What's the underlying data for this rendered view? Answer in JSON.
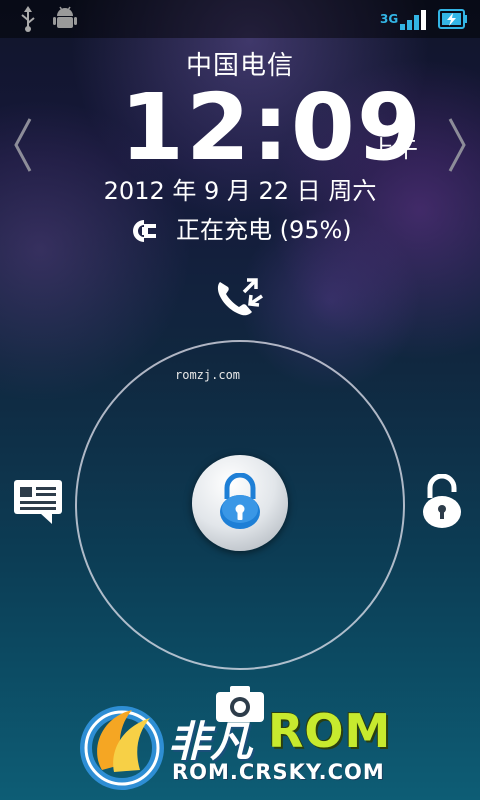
{
  "status_bar": {
    "network_type": "3G",
    "icons": [
      "usb-icon",
      "android-debug-icon",
      "signal-icon",
      "battery-charging-icon"
    ]
  },
  "lockscreen": {
    "carrier": "中国电信",
    "time": "12:09",
    "ampm": "上午",
    "date": "2012 年 9 月 22 日 周六",
    "charging_status": "正在充电 (95%)"
  },
  "watermark": "romzj.com",
  "unlock_targets": {
    "top": "missed-call-icon",
    "left": "message-icon",
    "right": "unlock-icon",
    "bottom": "camera-icon",
    "center": "lock-icon"
  },
  "brand": {
    "name_cn": "非凡",
    "name_rom": "ROM",
    "url": "ROM.CRSKY.COM"
  },
  "colors": {
    "accent_blue": "#33b5e5",
    "lock_blue": "#1e7fd6",
    "brand_green": "#c7ea2e"
  }
}
